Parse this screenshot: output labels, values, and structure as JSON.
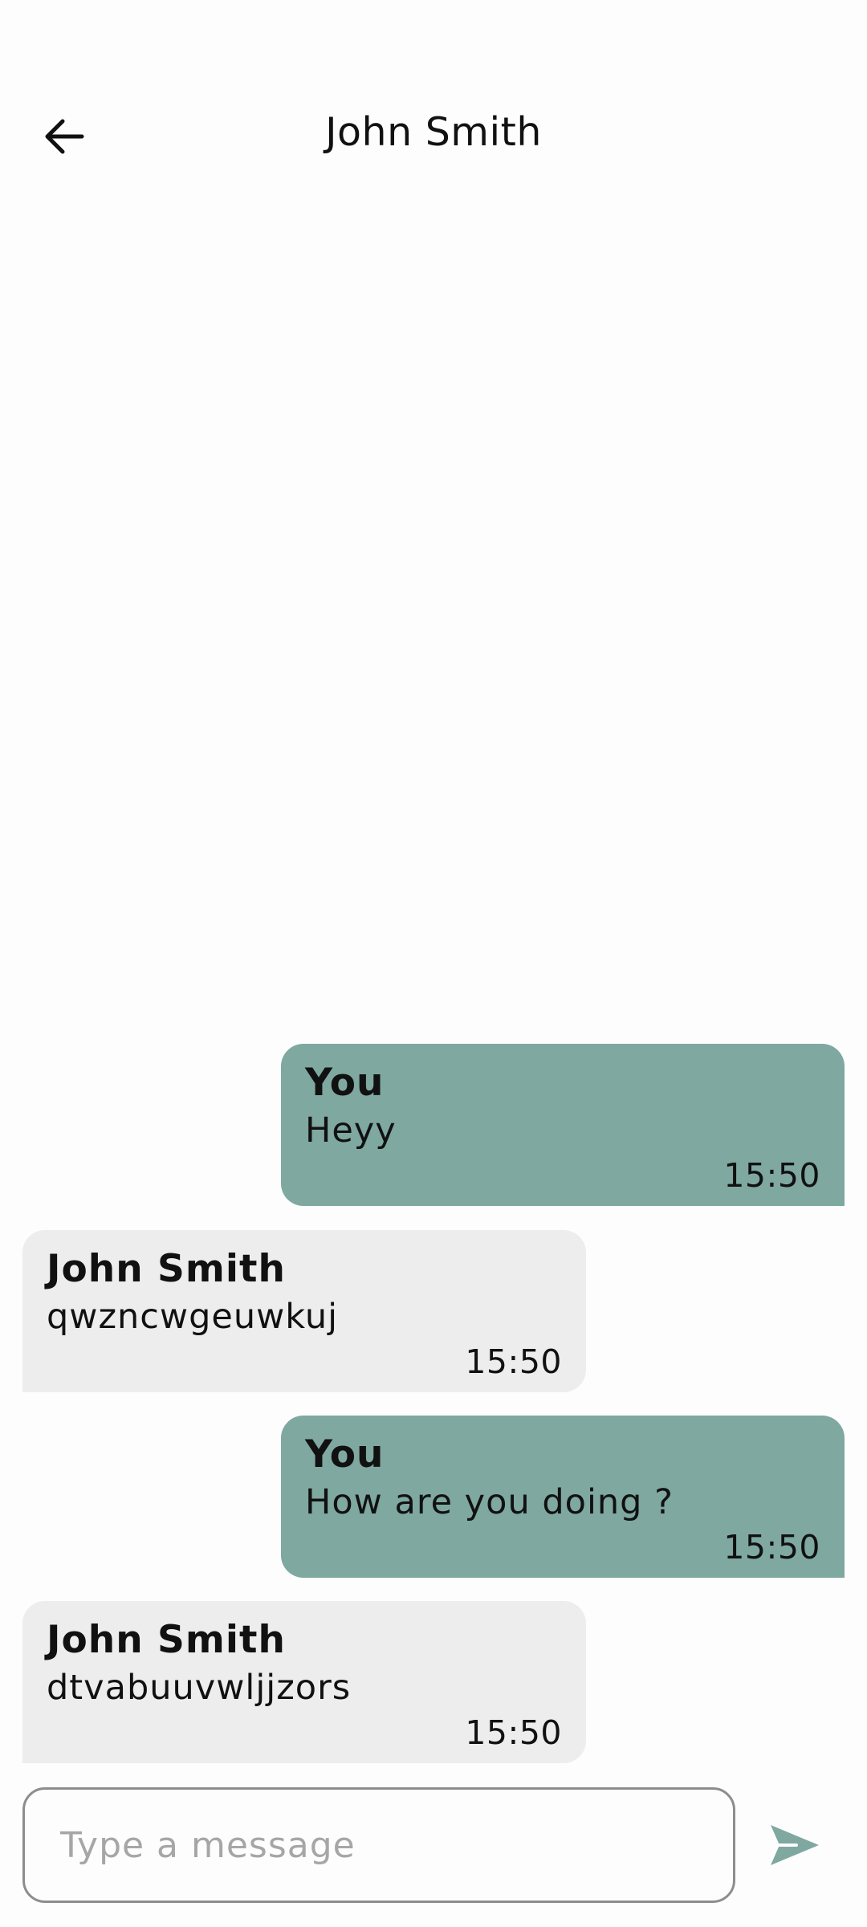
{
  "header": {
    "title": "John Smith"
  },
  "messages": [
    {
      "sender": "You",
      "text": "Heyy",
      "time": "15:50"
    },
    {
      "sender": "John Smith",
      "text": "qwzncwgeuwkuj",
      "time": "15:50"
    },
    {
      "sender": "You",
      "text": "How are you doing ?",
      "time": "15:50"
    },
    {
      "sender": "John Smith",
      "text": "dtvabuuvwljjzors",
      "time": "15:50"
    }
  ],
  "composer": {
    "placeholder": "Type a message"
  },
  "colors": {
    "sent_bubble": "#7ea8a0",
    "received_bubble": "#ededed",
    "accent": "#7ea8a0"
  },
  "icons": {
    "back": "arrow-left-icon",
    "send": "send-icon"
  }
}
